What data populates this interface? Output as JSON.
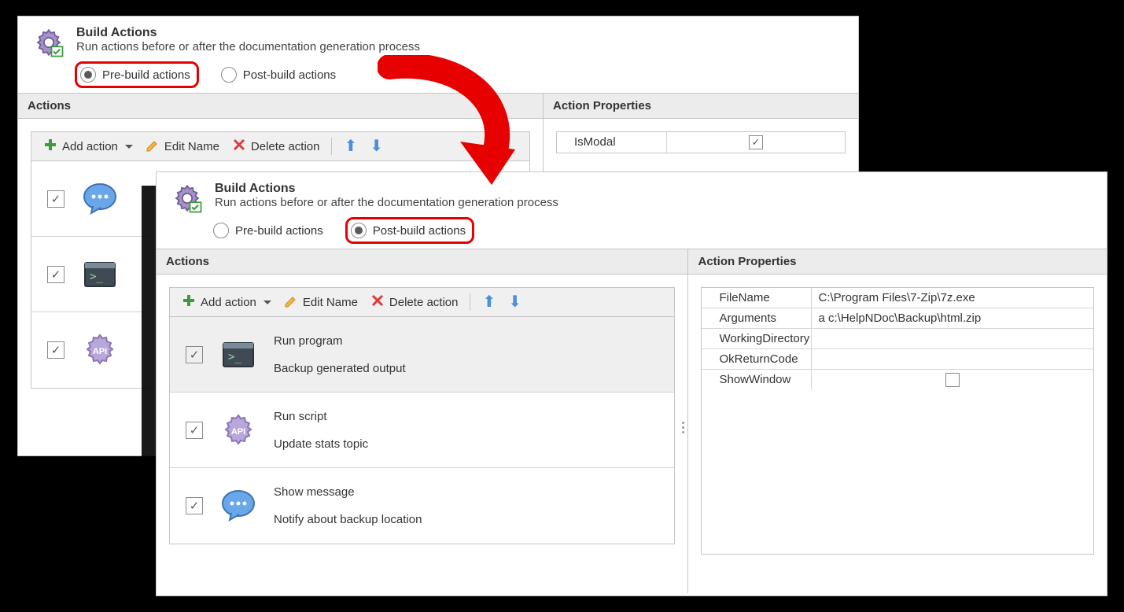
{
  "header": {
    "title": "Build Actions",
    "desc": "Run actions before or after the documentation generation process",
    "radio_pre": "Pre-build actions",
    "radio_post": "Post-build actions"
  },
  "sections": {
    "actions": "Actions",
    "props": "Action Properties"
  },
  "toolbar": {
    "add": "Add action",
    "edit": "Edit Name",
    "del": "Delete action"
  },
  "panel1": {
    "props": [
      {
        "key": "IsModal",
        "value": "",
        "checkbox": true,
        "checked": true
      }
    ]
  },
  "panel2": {
    "actions": [
      {
        "icon": "terminal",
        "title": "Run program",
        "sub": "Backup generated output",
        "selected": true
      },
      {
        "icon": "api",
        "title": "Run script",
        "sub": "Update stats topic"
      },
      {
        "icon": "message",
        "title": "Show message",
        "sub": "Notify about backup location"
      }
    ],
    "props": [
      {
        "key": "FileName",
        "value": "C:\\Program Files\\7-Zip\\7z.exe"
      },
      {
        "key": "Arguments",
        "value": "a c:\\HelpNDoc\\Backup\\html.zip"
      },
      {
        "key": "WorkingDirectory",
        "value": ""
      },
      {
        "key": "OkReturnCode",
        "value": ""
      },
      {
        "key": "ShowWindow",
        "value": "",
        "checkbox": true,
        "checked": false
      }
    ]
  }
}
